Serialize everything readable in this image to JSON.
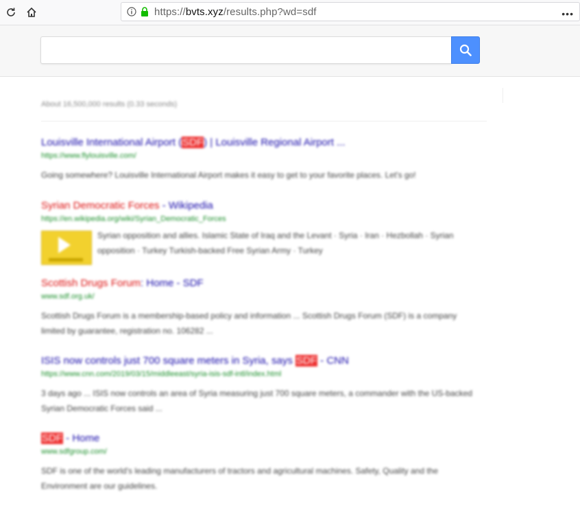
{
  "browser": {
    "url_prefix": "https://",
    "url_domain": "bvts.xyz",
    "url_path": "/results.php?wd=sdf",
    "more_label": "•••"
  },
  "search": {
    "query": "",
    "placeholder": "",
    "button_icon": "search-icon",
    "accent_color": "#4d90fe"
  },
  "results_stats": "About 16,500,000 results (0.33 seconds)",
  "results": [
    {
      "title_pre": "Louisville International Airport (",
      "title_hl": "SDF",
      "title_post": ") | Louisville Regional Airport ...",
      "url": "https://www.flylouisville.com/",
      "snippet": "Going somewhere? Louisville International Airport makes it easy to get to your favorite places. Let's go!"
    },
    {
      "title_hl": "Syrian Democratic Forces",
      "title_post": " - Wikipedia",
      "url": "https://en.wikipedia.org/wiki/Syrian_Democratic_Forces",
      "snippet": "Syrian opposition and allies. Islamic State of Iraq and the Levant · Syria · Iran · Hezbollah · Syrian opposition · Turkey Turkish-backed Free Syrian Army · Turkey"
    },
    {
      "title_hl": "Scottish Drugs Forum",
      "title_post": ": Home - SDF",
      "url": "www.sdf.org.uk/",
      "snippet": "Scottish Drugs Forum is a membership-based policy and information ... Scottish Drugs Forum (SDF) is a company limited by guarantee, registration no. 106282 ..."
    },
    {
      "title_pre": "ISIS now controls just 700 square meters in Syria, says ",
      "title_hl": "SDF",
      "title_post": " - CNN",
      "url": "https://www.cnn.com/2019/03/15/middleeast/syria-isis-sdf-intl/index.html",
      "snippet": "3 days ago ... ISIS now controls an area of Syria measuring just 700 square meters, a commander with the US-backed Syrian Democratic Forces said ..."
    },
    {
      "title_hl": "SDF",
      "title_post": " - Home",
      "url": "www.sdfgroup.com/",
      "snippet": "SDF is one of the world's leading manufacturers of tractors and agricultural machines. Safety, Quality and the Environment are our guidelines."
    }
  ]
}
